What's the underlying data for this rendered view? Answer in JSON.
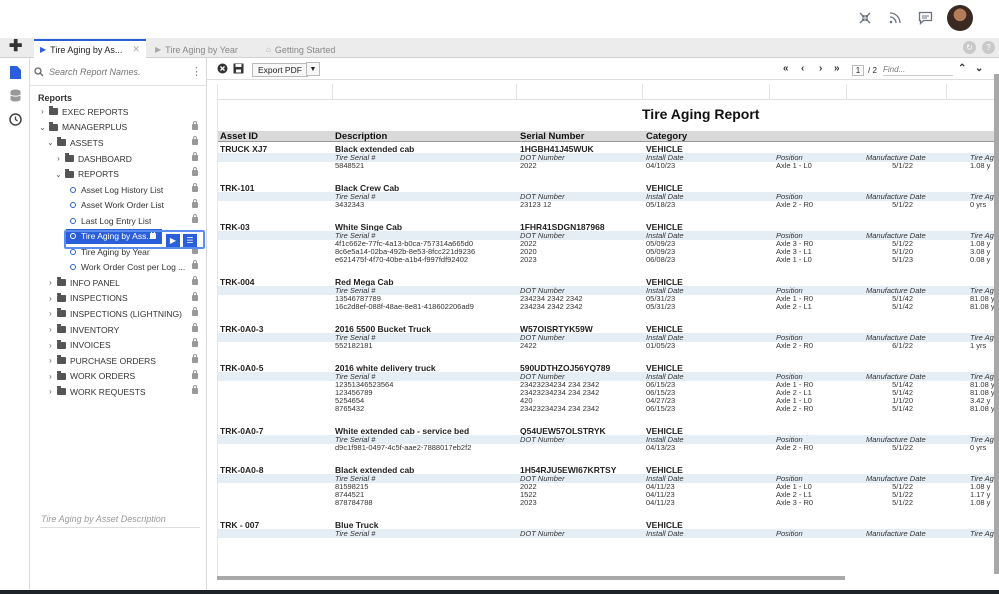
{
  "header": {
    "icons": [
      "collapse-icon",
      "rss-icon",
      "chat-icon"
    ]
  },
  "tabs": [
    {
      "label": "Tire Aging by As...",
      "active": true
    },
    {
      "label": "Tire Aging by Year",
      "active": false
    },
    {
      "label": "Getting Started",
      "active": false
    }
  ],
  "sidebar": {
    "search_placeholder": "Search Report Names.",
    "title": "Reports",
    "description": "Tire Aging by Asset Description",
    "tree": [
      {
        "label": "EXEC REPORTS",
        "type": "folder",
        "expanded": false,
        "level": 0,
        "locked": false
      },
      {
        "label": "MANAGERPLUS",
        "type": "folder",
        "expanded": true,
        "level": 0,
        "locked": true
      },
      {
        "label": "ASSETS",
        "type": "folder",
        "expanded": true,
        "level": 1,
        "locked": true
      },
      {
        "label": "DASHBOARD",
        "type": "folder",
        "expanded": false,
        "level": 2,
        "locked": true
      },
      {
        "label": "REPORTS",
        "type": "folder",
        "expanded": true,
        "level": 2,
        "locked": true
      },
      {
        "label": "Asset Log History List",
        "type": "report",
        "level": 3,
        "locked": true
      },
      {
        "label": "Asset Work Order List",
        "type": "report",
        "level": 3,
        "locked": true
      },
      {
        "label": "Last Log Entry List",
        "type": "report",
        "level": 3,
        "locked": true
      },
      {
        "label": "Tire Aging by Ass...",
        "type": "report",
        "level": 3,
        "locked": true,
        "selected": true
      },
      {
        "label": "Tire Aging by Year",
        "type": "report",
        "level": 3,
        "locked": true
      },
      {
        "label": "Work Order Cost per Log ...",
        "type": "report",
        "level": 3,
        "locked": true
      },
      {
        "label": "INFO PANEL",
        "type": "folder",
        "expanded": false,
        "level": 1,
        "locked": true
      },
      {
        "label": "INSPECTIONS",
        "type": "folder",
        "expanded": false,
        "level": 1,
        "locked": true
      },
      {
        "label": "INSPECTIONS (LIGHTNING)",
        "type": "folder",
        "expanded": false,
        "level": 1,
        "locked": true
      },
      {
        "label": "INVENTORY",
        "type": "folder",
        "expanded": false,
        "level": 1,
        "locked": true
      },
      {
        "label": "INVOICES",
        "type": "folder",
        "expanded": false,
        "level": 1,
        "locked": true
      },
      {
        "label": "PURCHASE ORDERS",
        "type": "folder",
        "expanded": false,
        "level": 1,
        "locked": true
      },
      {
        "label": "WORK ORDERS",
        "type": "folder",
        "expanded": false,
        "level": 1,
        "locked": true
      },
      {
        "label": "WORK REQUESTS",
        "type": "folder",
        "expanded": false,
        "level": 1,
        "locked": true
      }
    ]
  },
  "toolbar": {
    "export_label": "Export PDF",
    "page_current": "1",
    "page_total": "/ 2",
    "find_placeholder": "Find..."
  },
  "report": {
    "title": "Tire Aging Report",
    "columns": [
      "Asset ID",
      "Description",
      "Serial Number",
      "Category"
    ],
    "sub_columns": [
      "Tire Serial #",
      "DOT Number",
      "Install Date",
      "Position",
      "Manufacture Date",
      "Tire Ag"
    ],
    "groups": [
      {
        "asset": "TRUCK XJ7",
        "description": "Black extended cab",
        "serial": "1HGBH41J45WUK",
        "category": "VEHICLE",
        "tires": [
          [
            "5848521",
            "2022",
            "04/10/23",
            "Axle 1 - L0",
            "5/1/22",
            "1.08 y"
          ]
        ]
      },
      {
        "asset": "TRK-101",
        "description": "Black Crew Cab",
        "serial": "",
        "category": "VEHICLE",
        "tires": [
          [
            "3432343",
            "23123 12",
            "05/18/23",
            "Axle 2 - R0",
            "5/1/22",
            "0 yrs"
          ]
        ]
      },
      {
        "asset": "TRK-03",
        "description": "White Singe Cab",
        "serial": "1FHR41SDGN187968",
        "category": "VEHICLE",
        "tires": [
          [
            "4f1c662e-77fc-4a13-b0ca-757314a665d0",
            "2022",
            "05/09/23",
            "Axle 3 - R0",
            "5/1/22",
            "1.08 y"
          ],
          [
            "8c6e5a14-02ba-492b-8e53-8fcc221d9236",
            "2020",
            "05/09/23",
            "Axle 3 - L1",
            "5/1/20",
            "3.08 y"
          ],
          [
            "e621475f-4f70-40be-a1b4-f997fdf92402",
            "2023",
            "06/08/23",
            "Axle 1 - L0",
            "5/1/23",
            "0.08 y"
          ]
        ]
      },
      {
        "asset": "TRK-004",
        "description": "Red Mega Cab",
        "serial": "",
        "category": "VEHICLE",
        "tires": [
          [
            "13546787789",
            "234234 2342 2342",
            "05/31/23",
            "Axle 1 - R0",
            "5/1/42",
            "81.08 y"
          ],
          [
            "16c2d8ef-088f-48ae-8e81-418602206ad9",
            "234234 2342 2342",
            "05/31/23",
            "Axle 2 - L1",
            "5/1/42",
            "81.08 y"
          ]
        ]
      },
      {
        "asset": "TRK-0A0-3",
        "description": "2016 5500 Bucket Truck",
        "serial": "W57OISRTYK59W",
        "category": "VEHICLE",
        "tires": [
          [
            "552182181",
            "2422",
            "01/05/23",
            "Axle 2 - R0",
            "6/1/22",
            "1 yrs"
          ]
        ]
      },
      {
        "asset": "TRK-0A0-5",
        "description": "2016 white delivery truck",
        "serial": "590UDTHZOJ56YQ789",
        "category": "VEHICLE",
        "tires": [
          [
            "12351346523564",
            "23423234234 234 2342",
            "06/15/23",
            "Axle 1 - R0",
            "5/1/42",
            "81.08 y"
          ],
          [
            "123456789",
            "23423234234 234 2342",
            "06/15/23",
            "Axle 2 - L1",
            "5/1/42",
            "81.08 y"
          ],
          [
            "5254654",
            "420",
            "04/27/23",
            "Axle 1 - L0",
            "1/1/20",
            "3.42 y"
          ],
          [
            "8765432",
            "23423234234 234 2342",
            "06/15/23",
            "Axle 2 - R0",
            "5/1/42",
            "81.08 y"
          ]
        ]
      },
      {
        "asset": "TRK-0A0-7",
        "description": "White extended cab - service bed",
        "serial": "Q54UEW57OLSTRYK",
        "category": "VEHICLE",
        "tires": [
          [
            "d9c1f981-0497-4c5f-aae2-7888017eb2f2",
            "",
            "04/13/23",
            "Axle 2 - R0",
            "5/1/22",
            "0 yrs"
          ]
        ]
      },
      {
        "asset": "TRK-0A0-8",
        "description": "Black extended cab",
        "serial": "1H54RJU5EWI67KRTSY",
        "category": "VEHICLE",
        "tires": [
          [
            "81598215",
            "2022",
            "04/11/23",
            "Axle 1 - L0",
            "5/1/22",
            "1.08 y"
          ],
          [
            "8744521",
            "1522",
            "04/11/23",
            "Axle 2 - L1",
            "5/1/22",
            "1.17 y"
          ],
          [
            "878784788",
            "2023",
            "04/11/23",
            "Axle 3 - R0",
            "5/1/22",
            "1.08 y"
          ]
        ]
      },
      {
        "asset": "TRK - 007",
        "description": "Blue Truck",
        "serial": "",
        "category": "VEHICLE",
        "tires": [
          [
            "",
            "",
            "",
            "",
            "",
            ""
          ]
        ]
      }
    ]
  }
}
